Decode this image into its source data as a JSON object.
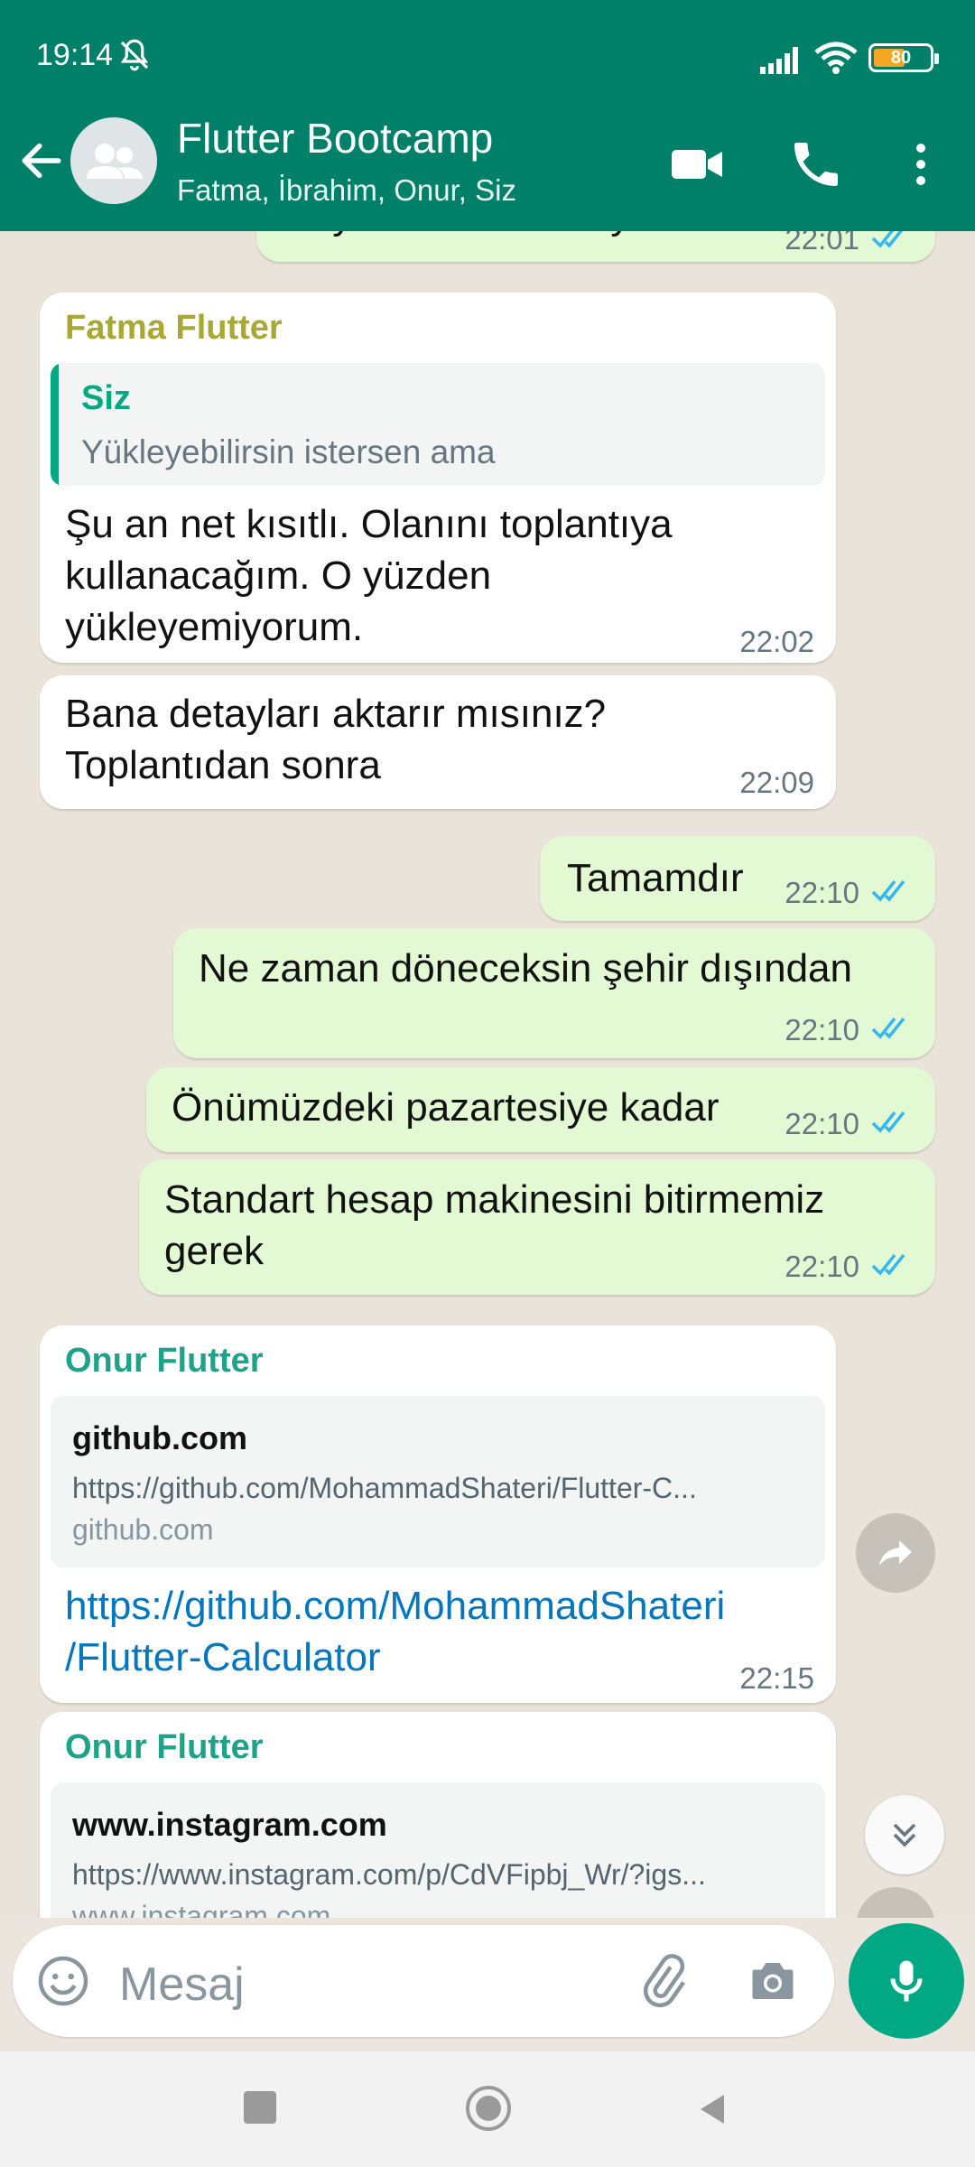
{
  "status_bar": {
    "time": "19:14",
    "battery": "80"
  },
  "header": {
    "title": "Flutter Bootcamp",
    "participants": "Fatma, İbrahim, Onur, Siz"
  },
  "messages": [
    {
      "text": "Duydum ama bilmiyorum",
      "time": "22:01"
    },
    {
      "sender": "Fatma Flutter",
      "quote_author": "Siz",
      "quote_text": "Yükleyebilirsin istersen ama",
      "line1": "Şu an net kısıtlı. Olanını toplantıya",
      "line2": "kullanacağım. O yüzden",
      "line3": "yükleyemiyorum.",
      "time": "22:02"
    },
    {
      "line1": "Bana detayları aktarır mısınız?",
      "line2": "Toplantıdan sonra",
      "time": "22:09"
    },
    {
      "text": "Tamamdır",
      "time": "22:10"
    },
    {
      "text": "Ne zaman döneceksin şehir dışından",
      "time": "22:10"
    },
    {
      "text": "Önümüzdeki pazartesiye kadar",
      "time": "22:10"
    },
    {
      "line1": "Standart hesap makinesini bitirmemiz",
      "line2": "gerek",
      "time": "22:10"
    },
    {
      "sender": "Onur Flutter",
      "card_title": "github.com",
      "card_url": "https://github.com/MohammadShateri/Flutter-C...",
      "card_domain": "github.com",
      "link_line1": "https://github.com/MohammadShateri",
      "link_line2": "/Flutter-Calculator",
      "time": "22:15"
    },
    {
      "sender": "Onur Flutter",
      "card_title": "www.instagram.com",
      "card_url": "https://www.instagram.com/p/CdVFipbj_Wr/?igs...",
      "card_domain": "www.instagram.com"
    }
  ],
  "input": {
    "placeholder": "Mesaj"
  },
  "colors": {
    "header": "#008069",
    "accent": "#00A884",
    "outgoing": "#E2F9D4",
    "incoming": "#FFFFFF",
    "fatma": "#A8A832",
    "onur": "#1FA28A",
    "tick": "#34B7F1"
  }
}
